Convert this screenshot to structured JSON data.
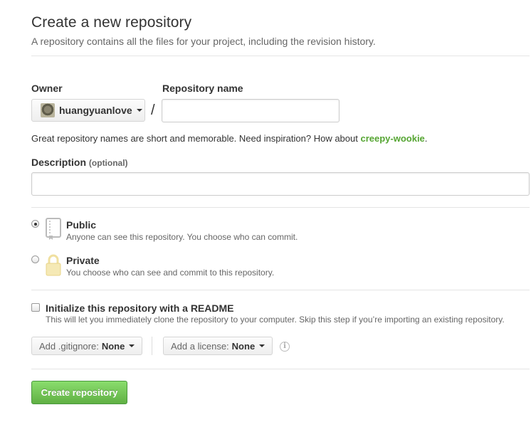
{
  "header": {
    "title": "Create a new repository",
    "subtitle": "A repository contains all the files for your project, including the revision history."
  },
  "owner": {
    "label": "Owner",
    "value": "huangyuanlove"
  },
  "separator": "/",
  "repo_name": {
    "label": "Repository name",
    "value": ""
  },
  "hint": {
    "text": "Great repository names are short and memorable. Need inspiration? How about ",
    "suggestion": "creepy-wookie",
    "suffix": "."
  },
  "description": {
    "label": "Description",
    "optional": "(optional)",
    "value": ""
  },
  "visibility": {
    "public": {
      "title": "Public",
      "desc": "Anyone can see this repository. You choose who can commit.",
      "selected": true
    },
    "private": {
      "title": "Private",
      "desc": "You choose who can see and commit to this repository.",
      "selected": false
    }
  },
  "readme": {
    "title": "Initialize this repository with a README",
    "desc": "This will let you immediately clone the repository to your computer. Skip this step if you’re importing an existing repository.",
    "checked": false
  },
  "gitignore": {
    "label": "Add .gitignore:",
    "value": "None"
  },
  "license": {
    "label": "Add a license:",
    "value": "None"
  },
  "submit": {
    "label": "Create repository"
  },
  "colors": {
    "accent_green": "#55a532",
    "button_green": "#60b044"
  }
}
